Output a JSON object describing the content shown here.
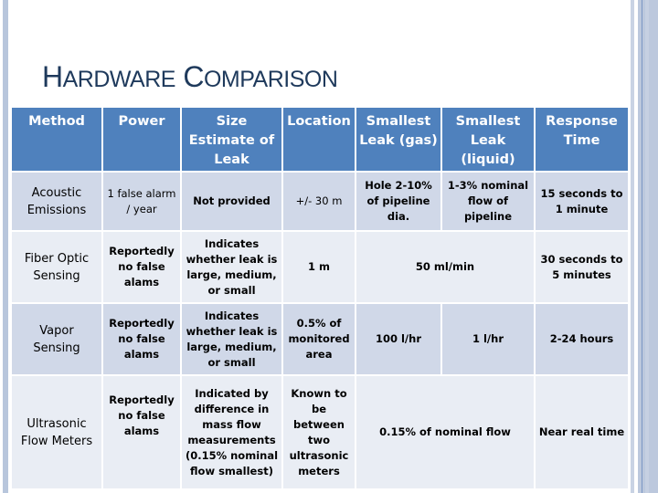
{
  "slide": {
    "title_parts": [
      {
        "cap": "H",
        "rest": "ARDWARE"
      },
      {
        "cap": "C",
        "rest": "OMPARISON"
      }
    ],
    "colors": {
      "header_bg": "#4f81bd",
      "row_odd_bg": "#d0d8e8",
      "row_even_bg": "#e9edf4",
      "title_color": "#1f3a5c",
      "side_bar": "#b8c6dc"
    }
  },
  "table": {
    "headers": [
      "Method",
      "Power",
      "Size Estimate of Leak",
      "Location",
      "Smallest Leak (gas)",
      "Smallest Leak (liquid)",
      "Response Time"
    ],
    "rows": [
      {
        "method": "Acoustic Emissions",
        "power": "1 false alarm / year",
        "size_estimate": "Not provided",
        "location": "+/- 30 m",
        "smallest_gas": "Hole 2-10% of pipeline dia.",
        "smallest_liquid": "1-3% nominal flow of pipeline",
        "response_time": "15 seconds to 1 minute"
      },
      {
        "method": "Fiber Optic Sensing",
        "power": "Reportedly no false alams",
        "size_estimate": "Indicates whether leak is large, medium, or small",
        "location": "1 m",
        "smallest_gas_liquid_merged": "50 ml/min",
        "response_time": "30 seconds to 5 minutes"
      },
      {
        "method": "Vapor Sensing",
        "power": "Reportedly no false alams",
        "size_estimate": "Indicates whether leak is large, medium, or small",
        "location": "0.5% of monitored area",
        "smallest_gas": "100 l/hr",
        "smallest_liquid": "1 l/hr",
        "response_time": "2-24 hours"
      },
      {
        "method": "Ultrasonic Flow Meters",
        "power": "Reportedly no false alams",
        "size_estimate": "Indicated by difference in mass flow measurements (0.15% nominal flow smallest)",
        "location": "Known to be between two ultrasonic meters",
        "smallest_gas_liquid_merged": "0.15%  of nominal flow",
        "response_time": "Near real time"
      }
    ]
  }
}
